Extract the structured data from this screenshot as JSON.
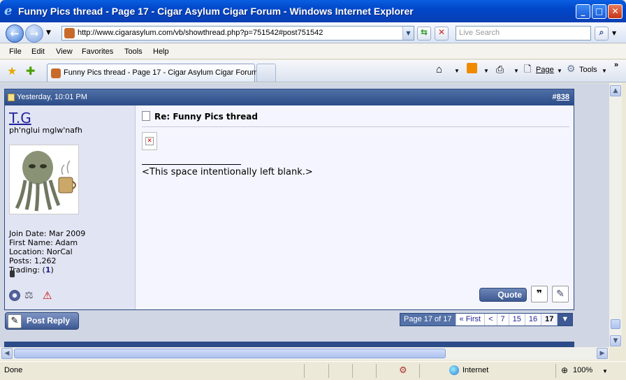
{
  "window": {
    "title": "Funny Pics thread - Page 17 - Cigar Asylum Cigar Forum - Windows Internet Explorer"
  },
  "address": {
    "url": "http://www.cigarasylum.com/vb/showthread.php?p=751542#post751542",
    "search_placeholder": "Live Search"
  },
  "menu": [
    "File",
    "Edit",
    "View",
    "Favorites",
    "Tools",
    "Help"
  ],
  "tab": {
    "label": "Funny Pics thread - Page 17 - Cigar Asylum Cigar Forum"
  },
  "toolbar": {
    "page_label": "Page",
    "tools_label": "Tools"
  },
  "post": {
    "date": "Yesterday, 10:01 PM",
    "number_prefix": "#",
    "number": "838",
    "username": "T.G",
    "user_title": "ph'nglui mglw'nafh",
    "join_date": "Join Date: Mar 2009",
    "first_name": "First Name: Adam",
    "location": "Location: NorCal",
    "posts": "Posts: 1,262",
    "trading_label": "Trading: (",
    "trading_value": "1",
    "trading_close": ")",
    "title": "Re: Funny Pics thread",
    "signature": "<This space intentionally left blank.>",
    "quote_label": "Quote"
  },
  "thread": {
    "reply_label": "Post Reply",
    "page_label": "Page 17 of 17",
    "first_label": "« First",
    "prev_label": "<",
    "pages": [
      "7",
      "15",
      "16"
    ],
    "current_page": "17",
    "menu_glyph": "▼"
  },
  "status": {
    "text": "Done",
    "zone": "Internet",
    "zoom": "100%"
  },
  "colors": {
    "post_header": "#2b4c88",
    "user_pane": "#e1e4f2",
    "link": "#22229c"
  }
}
